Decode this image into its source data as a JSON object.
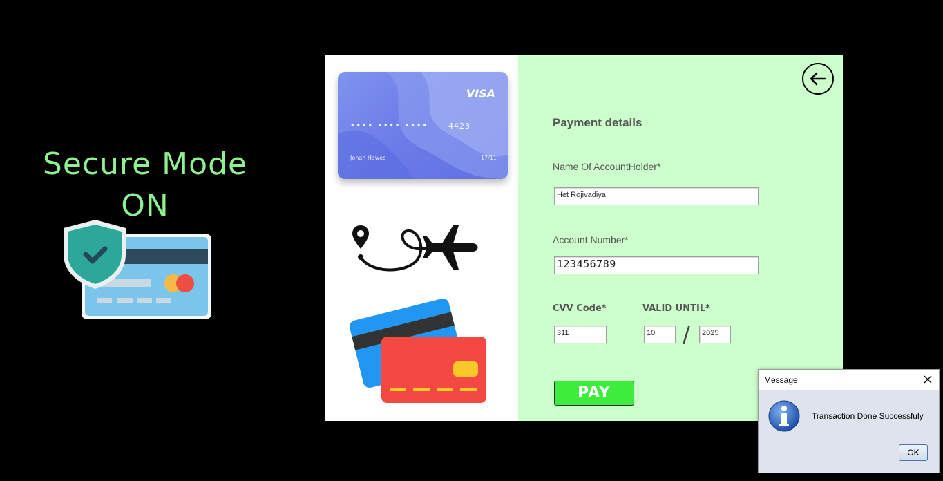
{
  "left_section": {
    "title_line1": "Secure Mode",
    "title_line2": "ON"
  },
  "visa_card": {
    "brand": "VISA",
    "dots": "•••• •••• ••••",
    "last_digits": "4423",
    "holder": "Jonah Hawes",
    "expiry": "17/11"
  },
  "form": {
    "title": "Payment details",
    "name_label": "Name Of AccountHolder*",
    "name_value": "Het Rojivadiya",
    "account_label": "Account Number*",
    "account_value": "123456789",
    "cvv_label": "CVV Code*",
    "cvv_value": "311",
    "valid_label": "VALID UNTIL*",
    "month_value": "10",
    "slash": "/",
    "year_value": "2025",
    "pay_label": "PAY"
  },
  "dialog": {
    "title": "Message",
    "message": "Transaction Done Successfuly",
    "ok_label": "OK"
  },
  "colors": {
    "background": "#000000",
    "secure_text": "#8ef08e",
    "form_panel": "#ccffcc",
    "pay_button": "#3ded3d"
  },
  "icons": [
    "secure-card-icon",
    "travel-route-icon",
    "credit-cards-icon",
    "back-arrow-icon",
    "info-icon",
    "close-icon"
  ]
}
